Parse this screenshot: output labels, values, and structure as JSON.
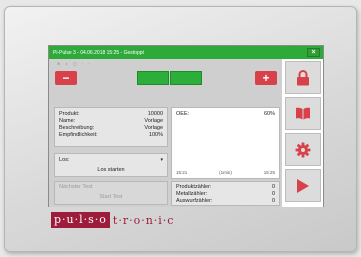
{
  "window": {
    "title": "Pi-Pulse 3 - 04.06.2018 15:25 - Gestoppt",
    "close_label": "×"
  },
  "toolbar": {
    "faded_icons": "⊕ ◐ ▢ ◦ ◦",
    "minus_label": "−",
    "plus_label": "+"
  },
  "product_info": {
    "rows": [
      {
        "label": "Produkt:",
        "value": "10000"
      },
      {
        "label": "Name:",
        "value": "Vorlage"
      },
      {
        "label": "Beschreibung:",
        "value": "Vorlage"
      },
      {
        "label": "Empfindlichkeit:",
        "value": "100%"
      }
    ]
  },
  "lot": {
    "label": "Los:",
    "start_label": "Los starten"
  },
  "test": {
    "next_label": "Nächster Test",
    "start_label": "Start Test"
  },
  "oee": {
    "label": "OEE:",
    "value": "60%",
    "axis": [
      "15:21",
      "(1min)",
      "15:25"
    ]
  },
  "counters": {
    "rows": [
      {
        "label": "Produktzähler:",
        "value": "0"
      },
      {
        "label": "Metallzähler:",
        "value": "0"
      },
      {
        "label": "Auswurfzähler:",
        "value": "0"
      }
    ]
  },
  "sidebar": {
    "buttons": [
      {
        "icon": "lock-icon"
      },
      {
        "icon": "book-icon"
      },
      {
        "icon": "gear-icon"
      },
      {
        "icon": "play-icon"
      }
    ]
  },
  "brand": {
    "part1": "p·u·l·s·o",
    "part2": "t·r·o·n·i·c",
    "color": "#9d1c3b"
  },
  "colors": {
    "accent_green": "#2eaa3a",
    "button_red": "#d8404a"
  }
}
